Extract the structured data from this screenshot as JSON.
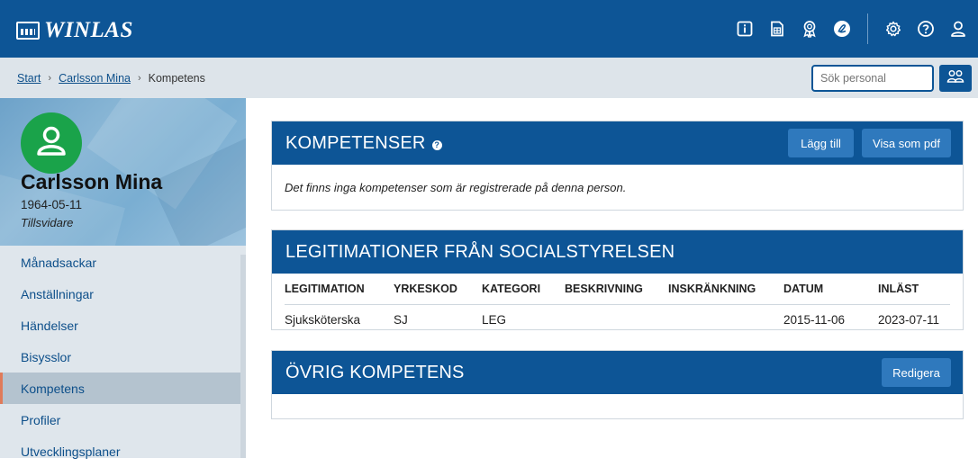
{
  "app": {
    "logo_text": "WINLAS"
  },
  "topbar": {
    "icons": [
      "info-icon",
      "calculator-icon",
      "award-icon",
      "signature-icon",
      "settings-gear-icon",
      "help-circle-icon",
      "user-icon"
    ]
  },
  "breadcrumb": {
    "items": [
      "Start",
      "Carlsson Mina",
      "Kompetens"
    ]
  },
  "search": {
    "placeholder": "Sök personal"
  },
  "profile": {
    "name": "Carlsson Mina",
    "dob": "1964-05-11",
    "role": "Tillsvidare"
  },
  "sidebar": {
    "items": [
      {
        "label": "Månadsackar"
      },
      {
        "label": "Anställningar"
      },
      {
        "label": "Händelser"
      },
      {
        "label": "Bisysslor"
      },
      {
        "label": "Kompetens",
        "active": true
      },
      {
        "label": "Profiler"
      },
      {
        "label": "Utvecklingsplaner"
      }
    ]
  },
  "kompetenser": {
    "title": "KOMPETENSER",
    "help": "?",
    "add_label": "Lägg till",
    "pdf_label": "Visa som pdf",
    "empty_message": "Det finns inga kompetenser som är registrerade på denna person."
  },
  "legitimationer": {
    "title": "LEGITIMATIONER FRÅN SOCIALSTYRELSEN",
    "columns": [
      "LEGITIMATION",
      "YRKESKOD",
      "KATEGORI",
      "BESKRIVNING",
      "INSKRÄNKNING",
      "DATUM",
      "INLÄST"
    ],
    "rows": [
      [
        "Sjuksköterska",
        "SJ",
        "LEG",
        "",
        "",
        "2015-11-06",
        "2023-07-11"
      ]
    ]
  },
  "ovrig": {
    "title": "ÖVRIG KOMPETENS",
    "edit_label": "Redigera"
  },
  "colors": {
    "primary": "#0d5596",
    "button": "#2f79bd",
    "avatar": "#1aa34a",
    "active_marker": "#e07b5a"
  }
}
